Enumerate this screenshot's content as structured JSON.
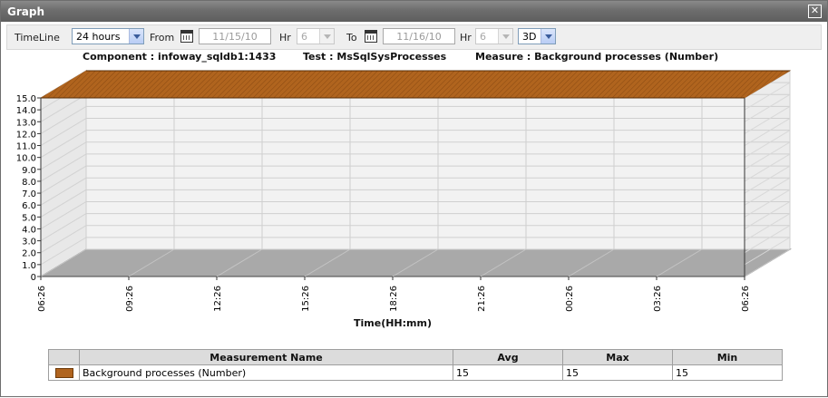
{
  "window": {
    "title": "Graph",
    "close_symbol": "✕"
  },
  "toolbar": {
    "timeline_label": "TimeLine",
    "timeline_value": "24 hours",
    "from_label": "From",
    "from_date": "11/15/10",
    "from_hr_label": "Hr",
    "from_hr_value": "6",
    "to_label": "To",
    "to_date": "11/16/10",
    "to_hr_label": "Hr",
    "to_hr_value": "6",
    "view_value": "3D"
  },
  "header": {
    "component": "Component : infoway_sqldb1:1433",
    "test": "Test : MsSqlSysProcesses",
    "measure": "Measure : Background processes  (Number)"
  },
  "chart_data": {
    "type": "area",
    "style": "3D",
    "x": [
      "06:26",
      "09:26",
      "12:26",
      "15:26",
      "18:26",
      "21:26",
      "00:26",
      "03:26",
      "06:26"
    ],
    "values": [
      15,
      15,
      15,
      15,
      15,
      15,
      15,
      15,
      15
    ],
    "xlabel": "Time(HH:mm)",
    "ylabel": "",
    "ylim": [
      0,
      15
    ],
    "yticks": [
      "0",
      "1.0",
      "2.0",
      "3.0",
      "4.0",
      "5.0",
      "6.0",
      "7.0",
      "8.0",
      "9.0",
      "10.0",
      "11.0",
      "12.0",
      "13.0",
      "14.0",
      "15.0"
    ],
    "grid": true,
    "color": "#b0641e"
  },
  "table": {
    "headers": [
      "",
      "Measurement Name",
      "Avg",
      "Max",
      "Min"
    ],
    "rows": [
      {
        "color": "#b0641e",
        "name": "Background processes (Number)",
        "avg": "15",
        "max": "15",
        "min": "15"
      }
    ]
  }
}
